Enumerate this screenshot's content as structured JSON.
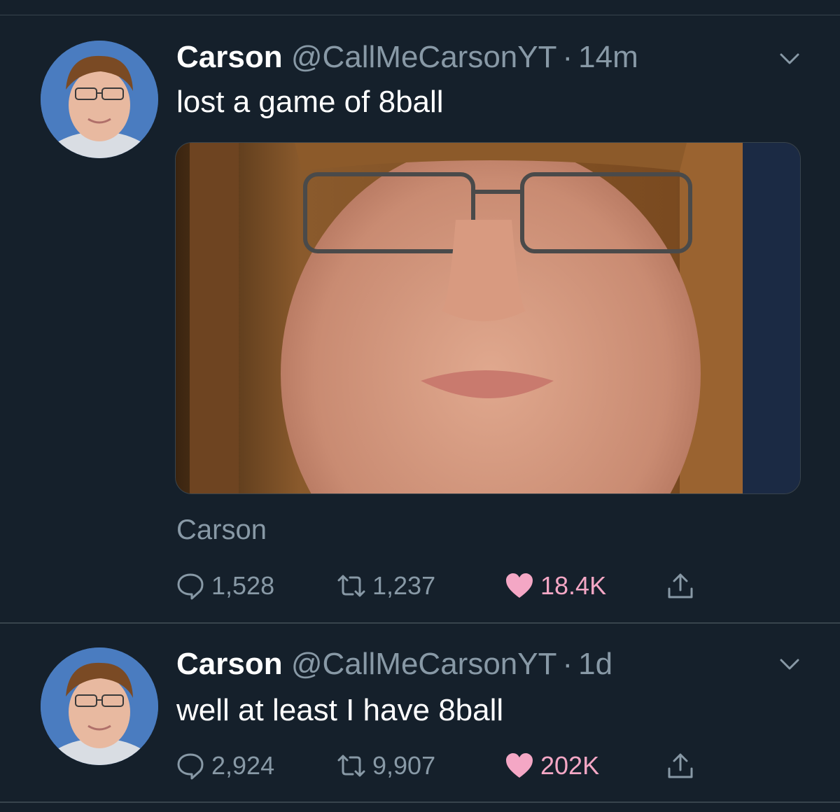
{
  "tweets": [
    {
      "name": "Carson",
      "handle": "@CallMeCarsonYT",
      "dot": "·",
      "time": "14m",
      "text": "lost a game of 8ball",
      "card_label": "Carson",
      "replies": "1,528",
      "retweets": "1,237",
      "likes": "18.4K",
      "liked": true
    },
    {
      "name": "Carson",
      "handle": "@CallMeCarsonYT",
      "dot": "·",
      "time": "1d",
      "text": "well at least I have 8ball",
      "replies": "2,924",
      "retweets": "9,907",
      "likes": "202K",
      "liked": true
    }
  ],
  "icons": {
    "reply": "reply-icon",
    "retweet": "retweet-icon",
    "like": "heart-icon",
    "share": "share-icon",
    "more": "chevron-down-icon"
  },
  "colors": {
    "background": "#15202b",
    "secondary_text": "#8899a6",
    "liked": "#f4a7c5",
    "divider": "#38444d"
  }
}
